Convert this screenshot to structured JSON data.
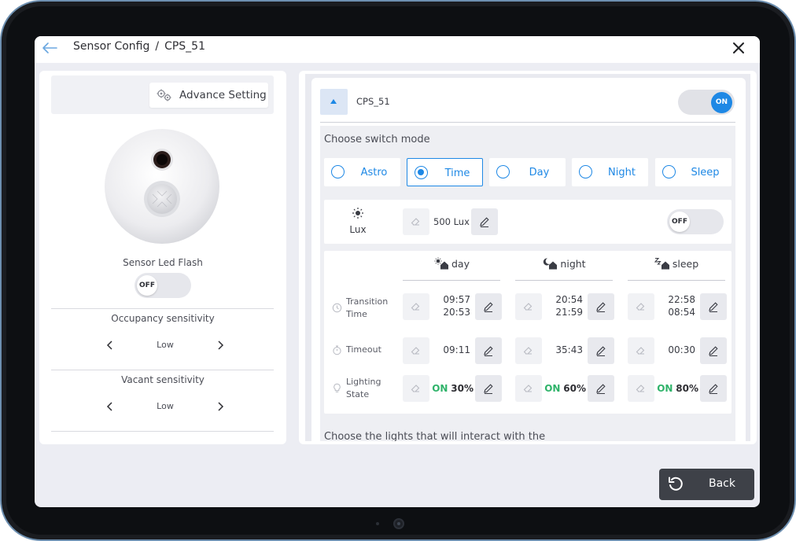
{
  "header": {
    "breadcrumb_root": "Sensor Config",
    "breadcrumb_sep": "/",
    "breadcrumb_current": "CPS_51",
    "back_icon": "arrow-left-icon",
    "close_icon": "close-icon"
  },
  "left": {
    "advance_setting_label": "Advance Setting",
    "led_flash_label": "Sensor Led Flash",
    "led_flash_state": "OFF",
    "occupancy": {
      "title": "Occupancy sensitivity",
      "value": "Low"
    },
    "vacant": {
      "title": "Vacant sensitivity",
      "value": "Low"
    }
  },
  "right": {
    "device_name": "CPS_51",
    "device_state": "ON",
    "switch_mode_label": "Choose switch mode",
    "modes": [
      {
        "label": "Astro",
        "selected": false
      },
      {
        "label": "Time",
        "selected": true
      },
      {
        "label": "Day",
        "selected": false
      },
      {
        "label": "Night",
        "selected": false
      },
      {
        "label": "Sleep",
        "selected": false
      }
    ],
    "lux": {
      "label": "Lux",
      "value": "500 Lux",
      "toggle": "OFF"
    },
    "columns": [
      "day",
      "night",
      "sleep"
    ],
    "rows": {
      "transition": {
        "label_line1": "Transition",
        "label_line2": "Time"
      },
      "timeout": {
        "label": "Timeout"
      },
      "lighting": {
        "label_line1": "Lighting",
        "label_line2": "State"
      }
    },
    "values": {
      "day": {
        "transition_start": "09:57",
        "transition_end": "20:53",
        "timeout": "09:11",
        "light_on": "ON",
        "light_pct": "30%"
      },
      "night": {
        "transition_start": "20:54",
        "transition_end": "21:59",
        "timeout": "35:43",
        "light_on": "ON",
        "light_pct": "60%"
      },
      "sleep": {
        "transition_start": "22:58",
        "transition_end": "08:54",
        "timeout": "00:30",
        "light_on": "ON",
        "light_pct": "80%"
      }
    },
    "cut_off_text": "Choose the lights that will interact with the"
  },
  "footer": {
    "back_label": "Back"
  },
  "colors": {
    "accent": "#1e88e5",
    "on_green": "#2fb36a",
    "back_button": "#3e4148"
  }
}
